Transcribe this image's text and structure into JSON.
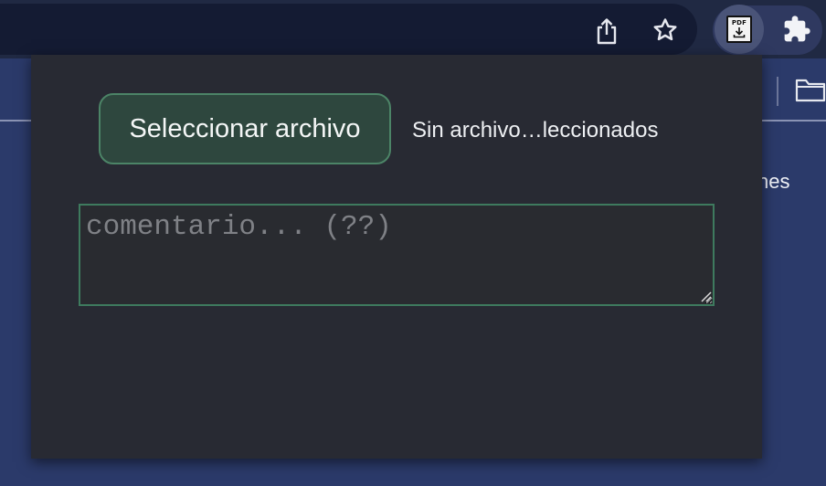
{
  "toolbar": {
    "icons": [
      "share-icon",
      "star-icon",
      "pdf-download-extension-icon",
      "puzzle-icon"
    ],
    "pdf_icon_text": "PDF"
  },
  "page": {
    "behind_text": "nes",
    "icons": [
      "folder-icon"
    ]
  },
  "popup": {
    "select_file_label": "Seleccionar archivo",
    "file_status": "Sin archivo…leccionados",
    "comment_placeholder": "comentario... (??)",
    "comment_value": ""
  },
  "colors": {
    "page_background": "#2b3a6a",
    "toolbar": "#202943",
    "popup_background": "#282a33",
    "button_fill": "#2e473e",
    "accent_green": "#4c8467"
  }
}
